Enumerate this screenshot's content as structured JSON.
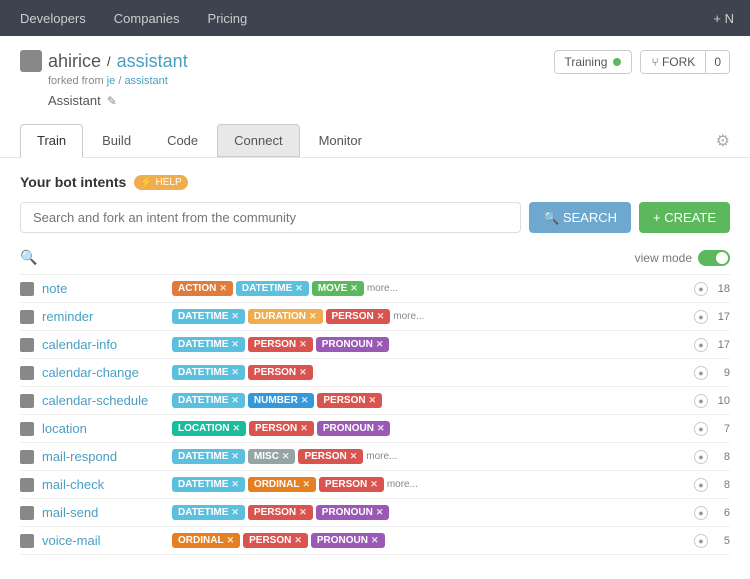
{
  "topnav": {
    "items": [
      "Developers",
      "Companies",
      "Pricing"
    ],
    "right_icon": "+ N"
  },
  "header": {
    "username": "ahirice",
    "slash": " / ",
    "repo": "assistant",
    "forked_label": "forked from",
    "forked_user": "je",
    "forked_repo": "assistant",
    "description": "Assistant",
    "edit_icon": "✎",
    "training_label": "Training",
    "fork_label": "⑂ FORK",
    "fork_count": "0"
  },
  "tabs": {
    "items": [
      "Train",
      "Build",
      "Code",
      "Connect",
      "Monitor"
    ],
    "active": "Train",
    "hovered": "Connect"
  },
  "intents": {
    "title": "Your bot intents",
    "help_label": "⚡ HELP",
    "search_placeholder": "Search and fork an intent from the community",
    "search_btn": "🔍 SEARCH",
    "create_btn": "+ CREATE",
    "view_mode_label": "view mode",
    "rows": [
      {
        "name": "note",
        "tags": [
          {
            "label": "ACTION",
            "cls": "tag-action"
          },
          {
            "label": "DATETIME",
            "cls": "tag-datetime"
          },
          {
            "label": "MOVE",
            "cls": "tag-move"
          }
        ],
        "more": "more...",
        "count": "18"
      },
      {
        "name": "reminder",
        "tags": [
          {
            "label": "DATETIME",
            "cls": "tag-datetime"
          },
          {
            "label": "DURATION",
            "cls": "tag-duration"
          },
          {
            "label": "PERSON",
            "cls": "tag-person"
          }
        ],
        "more": "more...",
        "count": "17"
      },
      {
        "name": "calendar-info",
        "tags": [
          {
            "label": "DATETIME",
            "cls": "tag-datetime"
          },
          {
            "label": "PERSON",
            "cls": "tag-person"
          },
          {
            "label": "PRONOUN",
            "cls": "tag-pronoun"
          }
        ],
        "more": "",
        "count": "17"
      },
      {
        "name": "calendar-change",
        "tags": [
          {
            "label": "DATETIME",
            "cls": "tag-datetime"
          },
          {
            "label": "PERSON",
            "cls": "tag-person"
          }
        ],
        "more": "",
        "count": "9"
      },
      {
        "name": "calendar-schedule",
        "tags": [
          {
            "label": "DATETIME",
            "cls": "tag-datetime"
          },
          {
            "label": "NUMBER",
            "cls": "tag-number"
          },
          {
            "label": "PERSON",
            "cls": "tag-person"
          }
        ],
        "more": "",
        "count": "10"
      },
      {
        "name": "location",
        "tags": [
          {
            "label": "LOCATION",
            "cls": "tag-location"
          },
          {
            "label": "PERSON",
            "cls": "tag-person"
          },
          {
            "label": "PRONOUN",
            "cls": "tag-pronoun"
          }
        ],
        "more": "",
        "count": "7"
      },
      {
        "name": "mail-respond",
        "tags": [
          {
            "label": "DATETIME",
            "cls": "tag-datetime"
          },
          {
            "label": "MISC",
            "cls": "tag-misc"
          },
          {
            "label": "PERSON",
            "cls": "tag-person"
          }
        ],
        "more": "more...",
        "count": "8"
      },
      {
        "name": "mail-check",
        "tags": [
          {
            "label": "DATETIME",
            "cls": "tag-datetime"
          },
          {
            "label": "ORDINAL",
            "cls": "tag-ordinal"
          },
          {
            "label": "PERSON",
            "cls": "tag-person"
          }
        ],
        "more": "more...",
        "count": "8"
      },
      {
        "name": "mail-send",
        "tags": [
          {
            "label": "DATETIME",
            "cls": "tag-datetime"
          },
          {
            "label": "PERSON",
            "cls": "tag-person"
          },
          {
            "label": "PRONOUN",
            "cls": "tag-pronoun"
          }
        ],
        "more": "",
        "count": "6"
      },
      {
        "name": "voice-mail",
        "tags": [
          {
            "label": "ORDINAL",
            "cls": "tag-ordinal"
          },
          {
            "label": "PERSON",
            "cls": "tag-person"
          },
          {
            "label": "PRONOUN",
            "cls": "tag-pronoun"
          }
        ],
        "more": "",
        "count": "5"
      }
    ]
  }
}
